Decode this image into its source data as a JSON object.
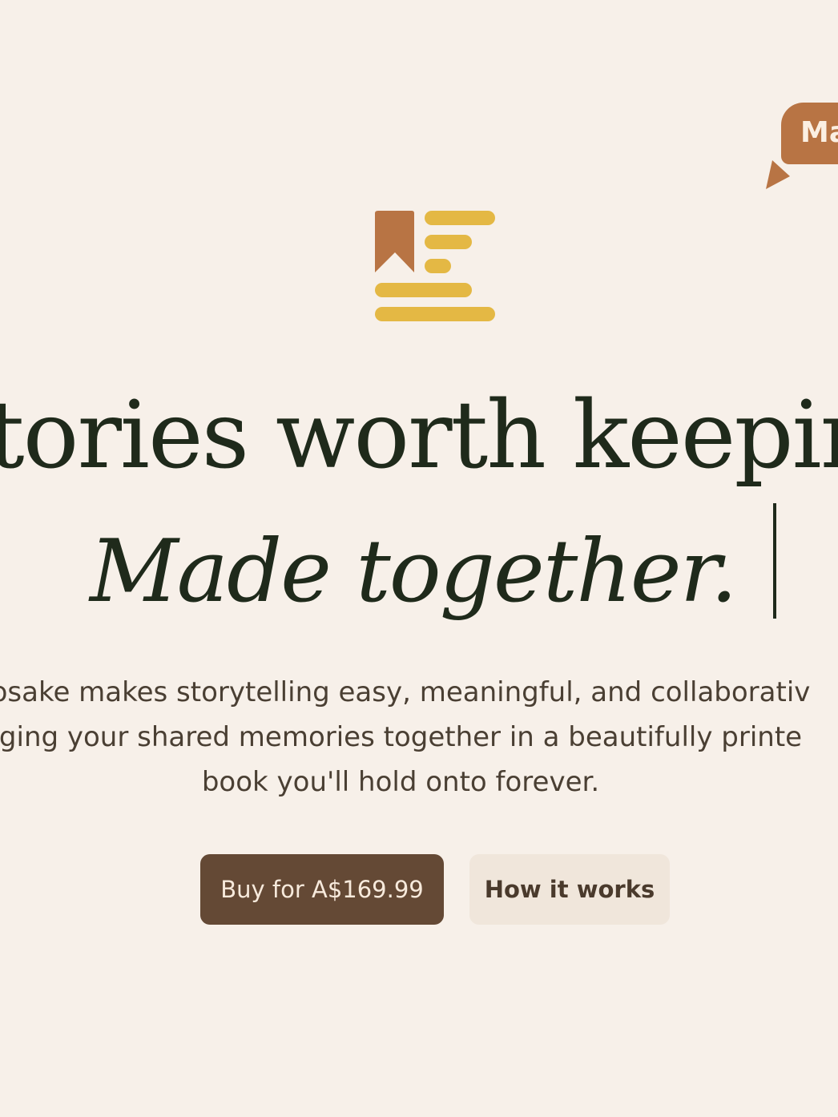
{
  "speech_bubble": {
    "text": "Ma",
    "color": "#b87444"
  },
  "logo": {
    "icon": "bookmark-lines-logo",
    "bookmark_color": "#b87444",
    "lines_color": "#e4b844"
  },
  "hero": {
    "headline_line1": "tories worth keepin",
    "headline_line2": "Made together.",
    "subcopy_lines": [
      "osake makes storytelling easy, meaningful, and collaborativ",
      "ging your shared memories together in a beautifully printe",
      "book you'll hold onto forever."
    ]
  },
  "actions": {
    "buy_label": "Buy for A$169.99",
    "how_label": "How it works"
  },
  "colors": {
    "background": "#f7f0e9",
    "text_dark": "#1f2a1b",
    "button_primary": "#644935",
    "button_secondary": "#f0e6db"
  }
}
